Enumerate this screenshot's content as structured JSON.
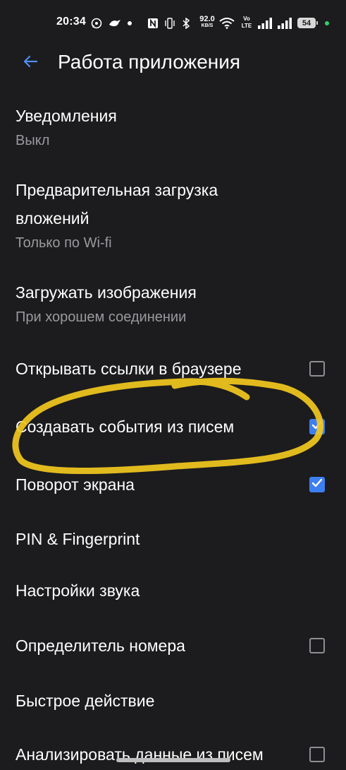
{
  "status_bar": {
    "time": "20:34",
    "net_speed_value": "92.0",
    "net_speed_unit": "KB/S",
    "volte_top": "Vo",
    "volte_bottom": "LTE",
    "battery": "54",
    "icons": [
      "whatsapp-icon",
      "bird-icon",
      "notification-dot-icon",
      "nfc-icon",
      "vibrate-icon",
      "bluetooth-icon",
      "wifi-icon",
      "signal-icon",
      "signal-icon-2"
    ]
  },
  "app_bar": {
    "title": "Работа приложения",
    "back_icon": "arrow-left-icon"
  },
  "settings": [
    {
      "title": "Уведомления",
      "subtitle": "Выкл"
    },
    {
      "title": "Предварительная загрузка вложений",
      "subtitle": "Только по Wi-fi"
    },
    {
      "title": "Загружать изображения",
      "subtitle": "При хорошем соединении"
    },
    {
      "title": "Открывать ссылки в браузере",
      "checked": false
    },
    {
      "title": "Создавать события из писем",
      "checked": true
    },
    {
      "title": "Поворот экрана",
      "checked": true
    },
    {
      "title": "PIN & Fingerprint"
    },
    {
      "title": "Настройки звука"
    },
    {
      "title": "Определитель номера",
      "checked": false
    },
    {
      "title": "Быстрое действие"
    },
    {
      "title": "Анализировать данные из писем",
      "checked": false
    }
  ],
  "colors": {
    "background": "#1c1c1e",
    "accent": "#3d7ff0",
    "subtitle": "#9a9a9e",
    "highlight": "#f2c81e"
  }
}
